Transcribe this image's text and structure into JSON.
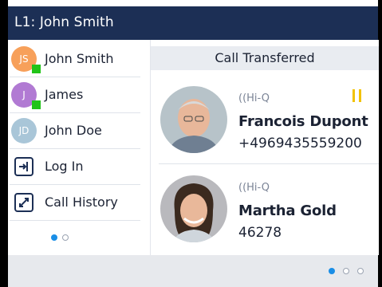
{
  "title_bar": {
    "title": "L1: John Smith"
  },
  "sidebar": {
    "items": [
      {
        "label": "John Smith",
        "initials": "JS",
        "avatar_color": "#f7a05a",
        "presence": "available"
      },
      {
        "label": "James",
        "initials": "J",
        "avatar_color": "#b17ad3",
        "presence": "available"
      },
      {
        "label": "John Doe",
        "initials": "JD",
        "avatar_color": "#a9c6d8",
        "presence": "none"
      },
      {
        "label": "Log In",
        "icon": "login-icon"
      },
      {
        "label": "Call History",
        "icon": "call-history-icon"
      }
    ],
    "page": {
      "current": 1,
      "total": 2
    }
  },
  "main": {
    "header": "Call Transferred",
    "calls": [
      {
        "codec": "Hi-Q",
        "name": "Francois Dupont",
        "number": "+4969435559200",
        "state_icon": "pause-icon"
      },
      {
        "codec": "Hi-Q",
        "name": "Martha Gold",
        "number": "46278"
      }
    ]
  },
  "softkeys": {
    "page": {
      "current": 1,
      "total": 3
    }
  },
  "colors": {
    "title_bar": "#1c2f55",
    "presence": "#21c419",
    "pause": "#f2c200",
    "pager_active": "#1a8ee6"
  }
}
